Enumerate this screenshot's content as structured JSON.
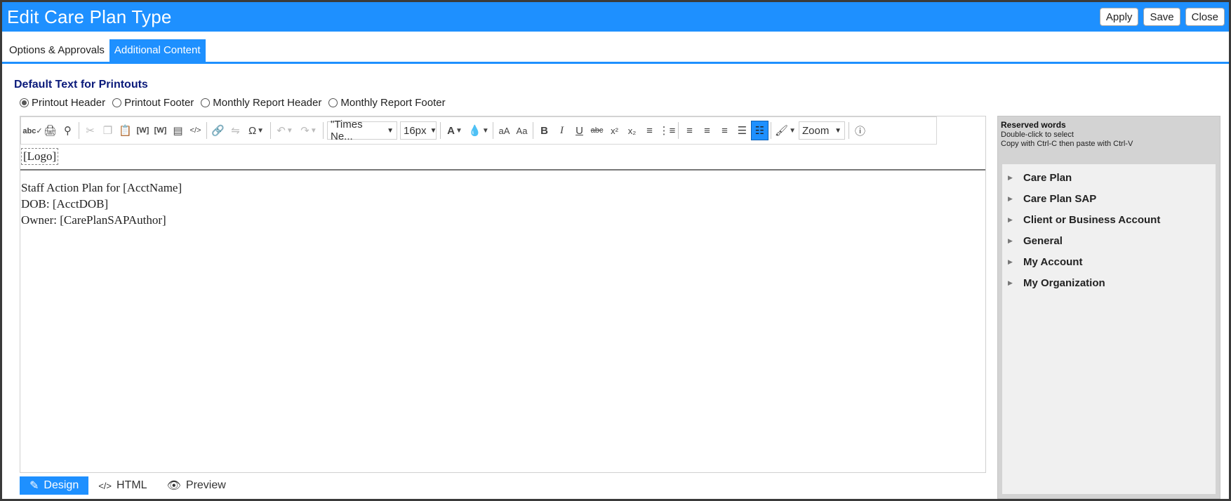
{
  "window": {
    "title": "Edit Care Plan Type",
    "buttons": [
      "Apply",
      "Save",
      "Close"
    ]
  },
  "tabs": [
    {
      "label": "Options & Approvals",
      "active": false
    },
    {
      "label": "Additional Content",
      "active": true
    }
  ],
  "section": {
    "title": "Default Text for Printouts",
    "radios": [
      {
        "label": "Printout Header",
        "checked": true
      },
      {
        "label": "Printout Footer",
        "checked": false
      },
      {
        "label": "Monthly Report Header",
        "checked": false
      },
      {
        "label": "Monthly Report Footer",
        "checked": false
      }
    ]
  },
  "toolbar": {
    "font_family": "\"Times Ne...",
    "font_size": "16px",
    "zoom": "Zoom",
    "icons": [
      "spellcheck-icon",
      "print-icon",
      "find-icon",
      "cut-icon",
      "copy-icon",
      "paste-icon",
      "paste-word-icon",
      "paste-word-icon",
      "paste-text-icon",
      "paste-html-icon",
      "link-icon",
      "unlink-icon",
      "special-char-icon",
      "undo-icon",
      "redo-icon",
      "font-color-icon",
      "background-color-icon",
      "lowercase-icon",
      "titlecase-icon",
      "bold-icon",
      "italic-icon",
      "underline-icon",
      "strikethrough-icon",
      "superscript-icon",
      "subscript-icon",
      "ordered-list-icon",
      "unordered-list-icon",
      "align-left-icon",
      "align-center-icon",
      "align-right-icon",
      "justify-icon",
      "clear-format-icon",
      "format-painter-icon",
      "help-icon"
    ]
  },
  "editor": {
    "logo_tag": "[Logo]",
    "lines": [
      "Staff Action Plan for [AcctName]",
      "DOB: [AcctDOB]",
      "Owner: [CarePlanSAPAuthor]"
    ]
  },
  "modes": [
    {
      "label": "Design",
      "icon": "pencil-icon",
      "active": true
    },
    {
      "label": "HTML",
      "icon": "code-icon",
      "active": false
    },
    {
      "label": "Preview",
      "icon": "eye-icon",
      "active": false
    }
  ],
  "reserved": {
    "title": "Reserved words",
    "hint1": "Double-click to select",
    "hint2": "Copy with Ctrl-C then paste with Ctrl-V",
    "items": [
      "Care Plan",
      "Care Plan SAP",
      "Client or Business Account",
      "General",
      "My Account",
      "My Organization"
    ]
  },
  "colors": {
    "accent": "#1e90ff",
    "section_title": "#0a1a7a"
  }
}
